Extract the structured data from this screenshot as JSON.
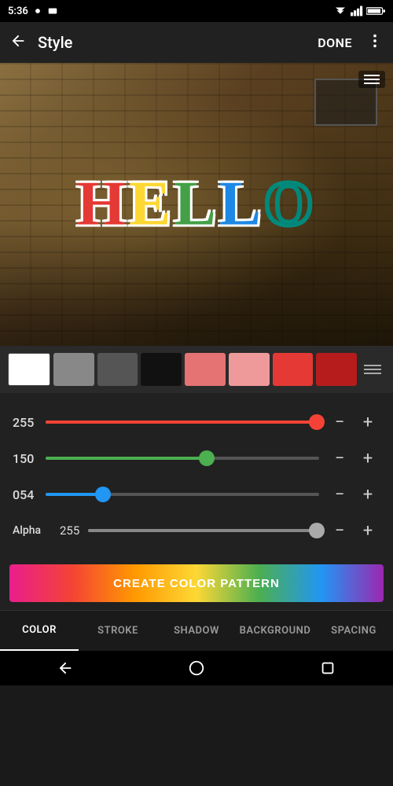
{
  "statusBar": {
    "time": "5:36",
    "icons": [
      "notification",
      "signal",
      "battery"
    ]
  },
  "topBar": {
    "title": "Style",
    "doneLabel": "DONE"
  },
  "preview": {
    "helloText": [
      "H",
      "E",
      "L",
      "L",
      "O"
    ]
  },
  "swatches": [
    {
      "color": "#ffffff",
      "label": "white"
    },
    {
      "color": "#888888",
      "label": "gray"
    },
    {
      "color": "#555555",
      "label": "dark-gray"
    },
    {
      "color": "#111111",
      "label": "black"
    },
    {
      "color": "#e57373",
      "label": "light-red"
    },
    {
      "color": "#ef9a9a",
      "label": "lighter-red"
    },
    {
      "color": "#e53935",
      "label": "red"
    },
    {
      "color": "#b71c1c",
      "label": "dark-red"
    }
  ],
  "sliders": [
    {
      "label": "255",
      "value": 255,
      "max": 255,
      "fillPercent": 100,
      "thumbPercent": 99,
      "colorClass": "red",
      "fillColor": "#f44336",
      "thumbColor": "#f44336"
    },
    {
      "label": "150",
      "value": 150,
      "max": 255,
      "fillPercent": 59,
      "thumbPercent": 59,
      "colorClass": "green",
      "fillColor": "#4caf50",
      "thumbColor": "#4caf50"
    },
    {
      "label": "054",
      "value": 54,
      "max": 255,
      "fillPercent": 21,
      "thumbPercent": 21,
      "colorClass": "blue",
      "fillColor": "#2196f3",
      "thumbColor": "#2196f3"
    },
    {
      "label": "Alpha",
      "valueLabel": "255",
      "value": 255,
      "max": 255,
      "fillPercent": 100,
      "thumbPercent": 99,
      "colorClass": "alpha",
      "fillColor": "#999",
      "thumbColor": "#aaa",
      "isAlpha": true
    }
  ],
  "createButton": {
    "label": "CREATE COLOR PATTERN"
  },
  "tabs": [
    {
      "id": "color",
      "label": "COLOR",
      "active": true
    },
    {
      "id": "stroke",
      "label": "STROKE",
      "active": false
    },
    {
      "id": "shadow",
      "label": "SHADOW",
      "active": false
    },
    {
      "id": "background",
      "label": "BACKGROUND",
      "active": false
    },
    {
      "id": "spacing",
      "label": "SPACING",
      "active": false
    }
  ]
}
